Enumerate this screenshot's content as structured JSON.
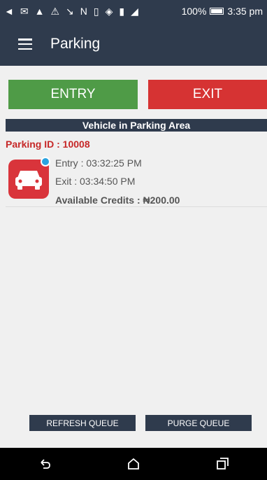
{
  "status_bar": {
    "icons": [
      "back-arrow-icon",
      "mail-icon",
      "app-icon",
      "warning-icon",
      "missed-call-icon",
      "nfc-icon",
      "vibrate-icon",
      "wifi-icon",
      "sim-icon",
      "signal-icon"
    ],
    "battery": "100%",
    "time": "3:35 pm"
  },
  "app_bar": {
    "title": "Parking"
  },
  "actions": {
    "entry_label": "ENTRY",
    "exit_label": "EXIT"
  },
  "section": {
    "title": "Vehicle in Parking Area"
  },
  "card": {
    "parking_id": "Parking ID : 10008",
    "entry": "Entry : 03:32:25 PM",
    "exit": "Exit : 03:34:50 PM",
    "credits": "Available Credits : ₦200.00"
  },
  "footer": {
    "refresh_label": "REFRESH QUEUE",
    "purge_label": "PURGE QUEUE"
  },
  "colors": {
    "bar": "#2f3b4d",
    "entry": "#4f9b47",
    "exit": "#d63333",
    "id_text": "#c62828",
    "avatar": "#d9343b",
    "badge": "#29a3e0"
  }
}
